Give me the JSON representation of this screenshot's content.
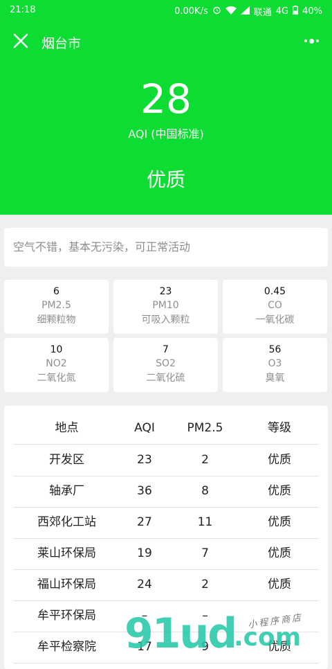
{
  "status_bar": {
    "time": "21:18",
    "network_speed": "0.00K/s",
    "carrier": "联通",
    "network_type": "4G",
    "battery": "40%"
  },
  "nav": {
    "title": "烟台市"
  },
  "aqi": {
    "value": "28",
    "standard": "AQI (中国标准)",
    "level": "优质"
  },
  "description": "空气不错，基本无污染，可正常活动",
  "pollutants": [
    {
      "value": "6",
      "key": "PM2.5",
      "name": "细颗粒物"
    },
    {
      "value": "23",
      "key": "PM10",
      "name": "可吸入颗粒"
    },
    {
      "value": "0.45",
      "key": "CO",
      "name": "一氧化碳"
    },
    {
      "value": "10",
      "key": "NO2",
      "name": "二氧化氮"
    },
    {
      "value": "7",
      "key": "SO2",
      "name": "二氧化硫"
    },
    {
      "value": "56",
      "key": "O3",
      "name": "臭氧"
    }
  ],
  "table": {
    "headers": [
      "地点",
      "AQI",
      "PM2.5",
      "等级"
    ],
    "rows": [
      [
        "开发区",
        "23",
        "2",
        "优质"
      ],
      [
        "轴承厂",
        "36",
        "8",
        "优质"
      ],
      [
        "西郊化工站",
        "27",
        "11",
        "优质"
      ],
      [
        "莱山环保局",
        "19",
        "7",
        "优质"
      ],
      [
        "福山环保局",
        "24",
        "2",
        "优质"
      ],
      [
        "牟平环保局",
        "–",
        "–",
        ""
      ],
      [
        "牟平检察院",
        "17",
        "9",
        "优质"
      ]
    ]
  },
  "watermark": {
    "brand": "91ud",
    "suffix": ".com",
    "tagline": "小程序商店"
  },
  "colors": {
    "header_bg": "#0ddc32",
    "page_bg": "#efefef",
    "watermark": "#21c7a8"
  }
}
